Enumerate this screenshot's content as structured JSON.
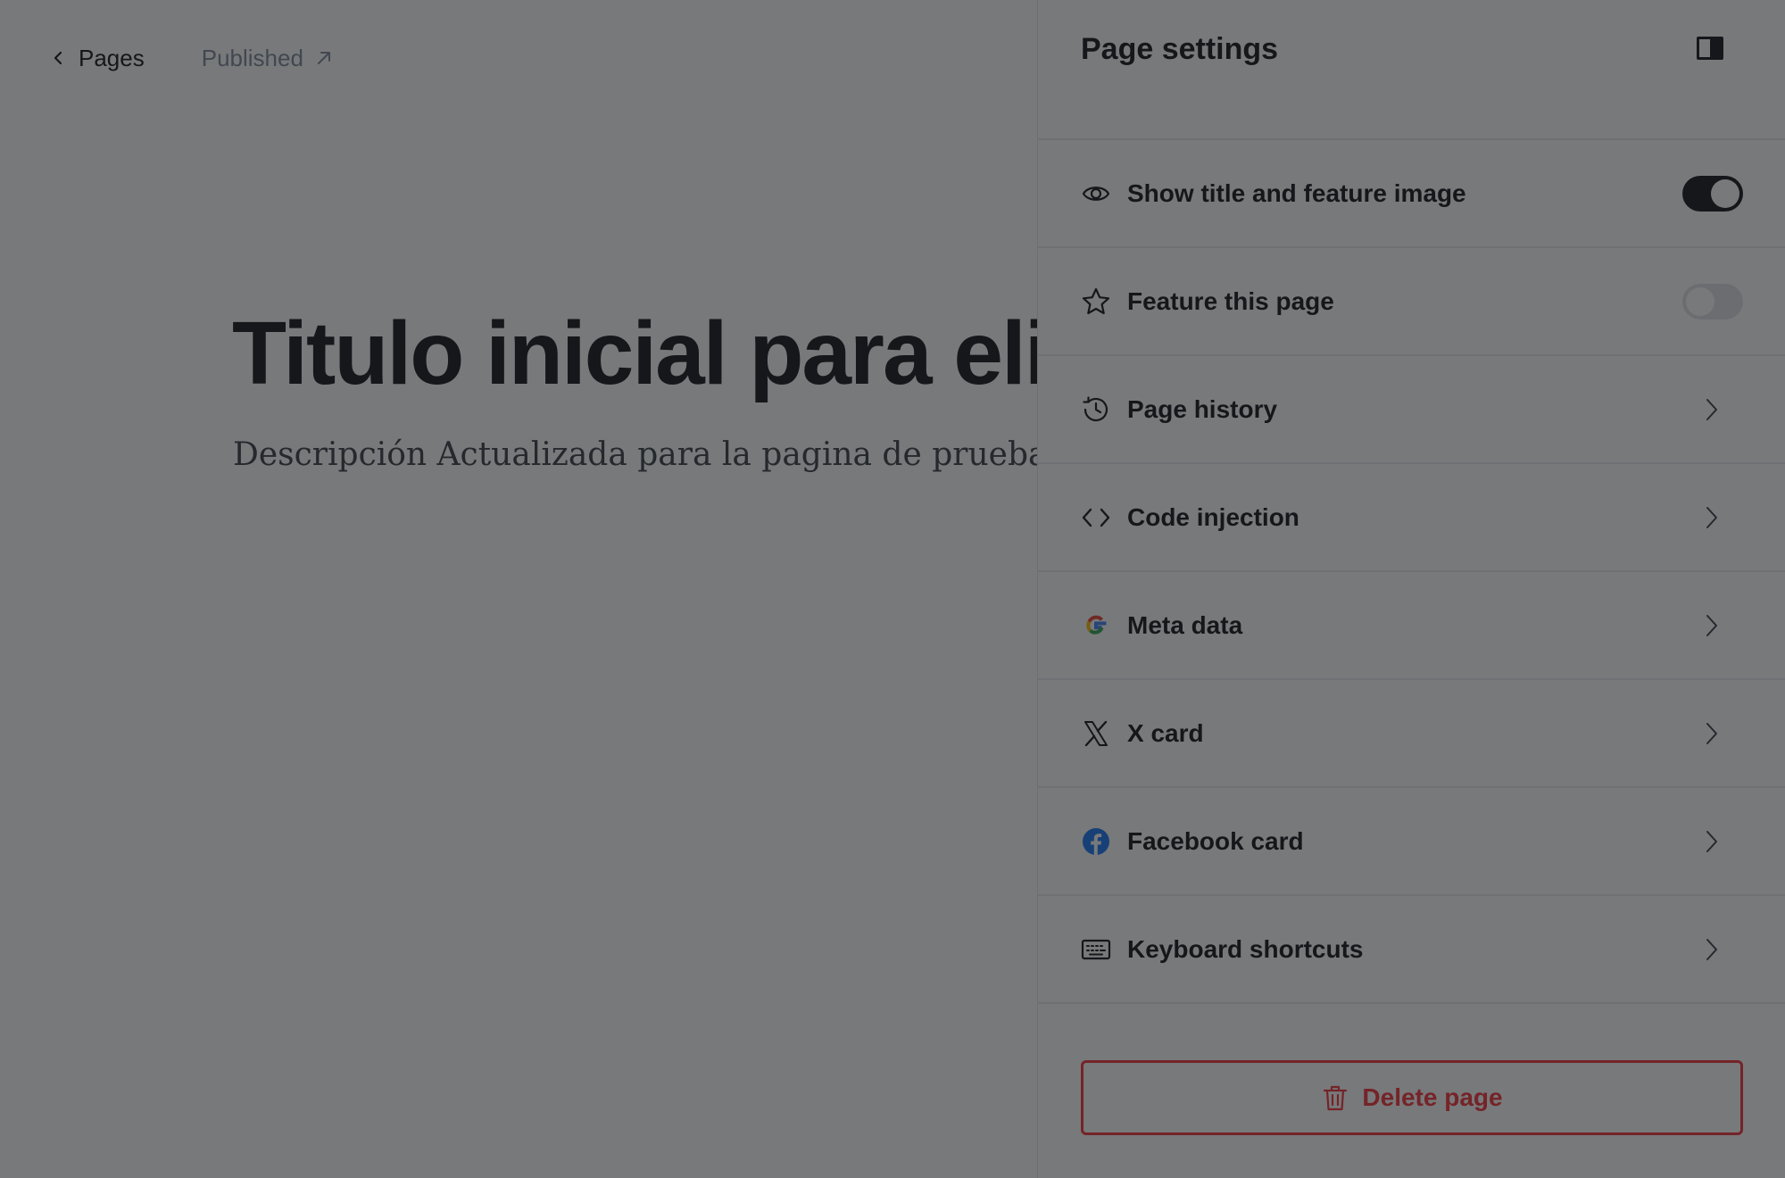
{
  "editor": {
    "back_label": "Pages",
    "status_label": "Published",
    "title": "Titulo inicial para eliminar",
    "excerpt": "Descripción Actualizada para la pagina de prueba a eliminar"
  },
  "panel": {
    "title": "Page settings",
    "toggle_rows": [
      {
        "label": "Show title and feature image",
        "icon": "eye-icon",
        "enabled": true
      },
      {
        "label": "Feature this page",
        "icon": "star-icon",
        "enabled": false
      }
    ],
    "nav_rows": [
      {
        "label": "Page history",
        "icon": "history-icon"
      },
      {
        "label": "Code injection",
        "icon": "code-icon"
      },
      {
        "label": "Meta data",
        "icon": "google-icon"
      },
      {
        "label": "X card",
        "icon": "x-icon"
      },
      {
        "label": "Facebook card",
        "icon": "facebook-icon"
      },
      {
        "label": "Keyboard shortcuts",
        "icon": "keyboard-icon"
      }
    ],
    "delete_label": "Delete page"
  },
  "colors": {
    "text": "#15171a",
    "muted": "#7c8b9a",
    "danger": "#f5353b",
    "facebook": "#1877f2",
    "overlay": "rgba(22,24,28,0.58)"
  }
}
